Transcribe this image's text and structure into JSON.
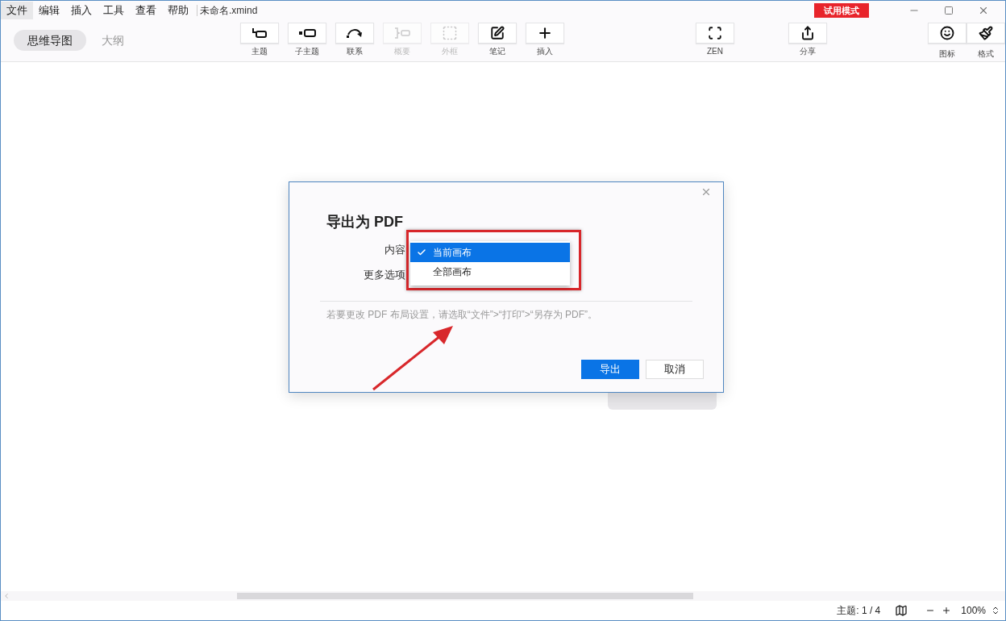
{
  "menu": [
    {
      "label": "文件",
      "selected": true
    },
    {
      "label": "编辑",
      "selected": false
    },
    {
      "label": "插入",
      "selected": false
    },
    {
      "label": "工具",
      "selected": false
    },
    {
      "label": "查看",
      "selected": false
    },
    {
      "label": "帮助",
      "selected": false
    }
  ],
  "file_name": "未命名.xmind",
  "trial_badge": "试用模式",
  "view_tabs": [
    {
      "label": "思维导图",
      "selected": true
    },
    {
      "label": "大纲",
      "selected": false
    }
  ],
  "toolbar_groups": [
    {
      "items": [
        {
          "kind": "topic",
          "label": "主题",
          "disabled": false
        },
        {
          "kind": "subtopic",
          "label": "子主题",
          "disabled": false
        },
        {
          "kind": "relation",
          "label": "联系",
          "disabled": false
        },
        {
          "kind": "summary",
          "label": "概要",
          "disabled": true
        },
        {
          "kind": "boundary",
          "label": "外框",
          "disabled": true
        },
        {
          "kind": "note",
          "label": "笔记",
          "disabled": false
        },
        {
          "kind": "insert",
          "label": "插入",
          "disabled": false
        }
      ]
    },
    {
      "items": [
        {
          "kind": "zen",
          "label": "ZEN",
          "disabled": false
        }
      ]
    },
    {
      "items": [
        {
          "kind": "share",
          "label": "分享",
          "disabled": false
        }
      ]
    },
    {
      "items": [
        {
          "kind": "emoji",
          "label": "图标",
          "disabled": false
        },
        {
          "kind": "format",
          "label": "格式",
          "disabled": false
        }
      ]
    }
  ],
  "dialog": {
    "title": "导出为 PDF",
    "fields": [
      {
        "label": "内容"
      },
      {
        "label": "更多选项"
      }
    ],
    "dropdown": [
      {
        "label": "当前画布",
        "selected": true
      },
      {
        "label": "全部画布",
        "selected": false
      }
    ],
    "note": "若要更改 PDF 布局设置，请选取“文件”>“打印”>“另存为 PDF”。",
    "buttons": [
      {
        "label": "导出",
        "kind": "primary"
      },
      {
        "label": "取消",
        "kind": "secondary"
      }
    ]
  },
  "status_bar": {
    "topic_count": "主题: 1 / 4",
    "zoom": "100%"
  }
}
